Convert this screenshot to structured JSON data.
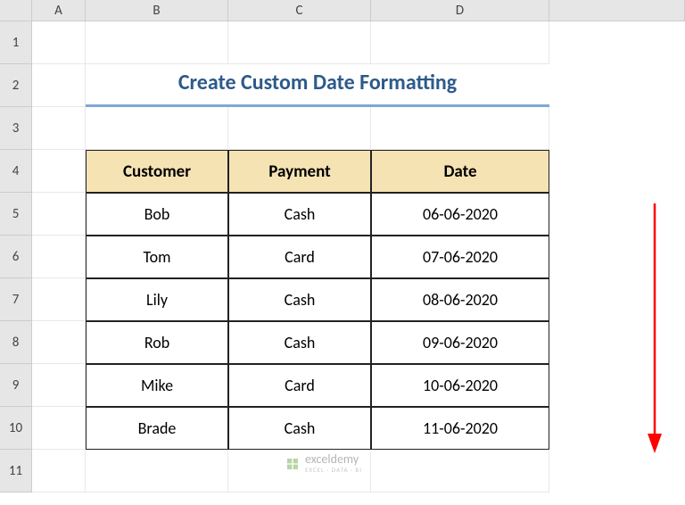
{
  "columns": [
    "A",
    "B",
    "C",
    "D"
  ],
  "rows": [
    "1",
    "2",
    "3",
    "4",
    "5",
    "6",
    "7",
    "8",
    "9",
    "10",
    "11"
  ],
  "title": "Create Custom Date Formatting",
  "headers": {
    "customer": "Customer",
    "payment": "Payment",
    "date": "Date"
  },
  "data": [
    {
      "customer": "Bob",
      "payment": "Cash",
      "date": "06-06-2020"
    },
    {
      "customer": "Tom",
      "payment": "Card",
      "date": "07-06-2020"
    },
    {
      "customer": "Lily",
      "payment": "Cash",
      "date": "08-06-2020"
    },
    {
      "customer": "Rob",
      "payment": "Cash",
      "date": "09-06-2020"
    },
    {
      "customer": "Mike",
      "payment": "Card",
      "date": "10-06-2020"
    },
    {
      "customer": "Brade",
      "payment": "Cash",
      "date": "11-06-2020"
    }
  ],
  "watermark": {
    "main": "exceldemy",
    "sub": "EXCEL · DATA · BI"
  }
}
